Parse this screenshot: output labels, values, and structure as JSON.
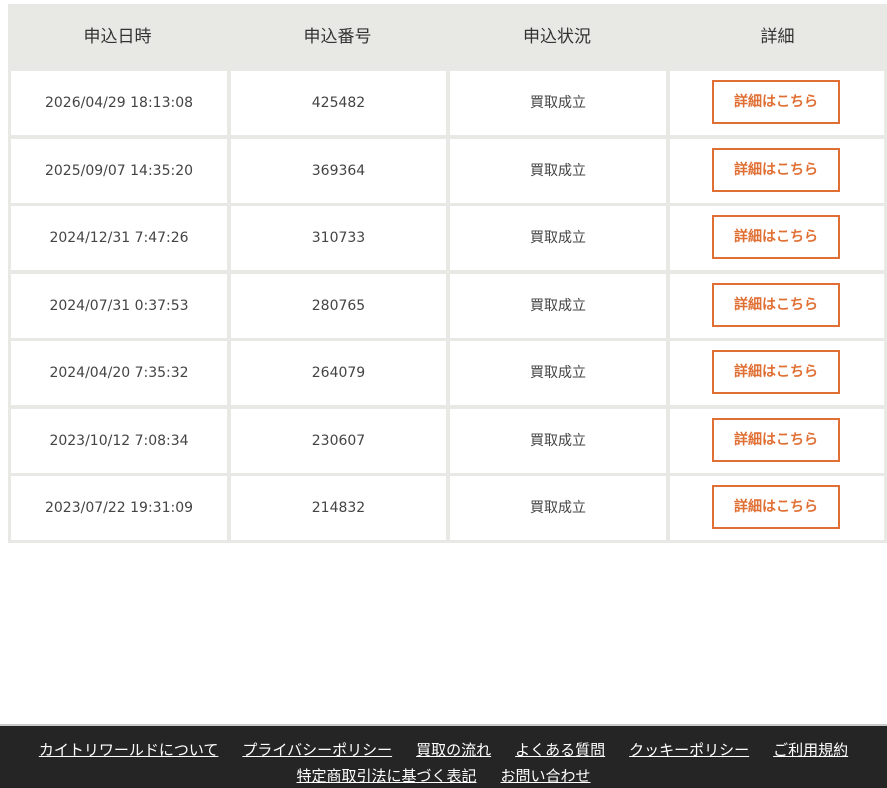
{
  "table": {
    "headers": [
      "申込日時",
      "申込番号",
      "申込状況",
      "詳細"
    ],
    "rows": [
      {
        "date": "2026/04/29 18:13:08",
        "number": "425482",
        "status": "買取成立",
        "detail_label": "詳細はこちら"
      },
      {
        "date": "2025/09/07 14:35:20",
        "number": "369364",
        "status": "買取成立",
        "detail_label": "詳細はこちら"
      },
      {
        "date": "2024/12/31 7:47:26",
        "number": "310733",
        "status": "買取成立",
        "detail_label": "詳細はこちら"
      },
      {
        "date": "2024/07/31 0:37:53",
        "number": "280765",
        "status": "買取成立",
        "detail_label": "詳細はこちら"
      },
      {
        "date": "2024/04/20 7:35:32",
        "number": "264079",
        "status": "買取成立",
        "detail_label": "詳細はこちら"
      },
      {
        "date": "2023/10/12 7:08:34",
        "number": "230607",
        "status": "買取成立",
        "detail_label": "詳細はこちら"
      },
      {
        "date": "2023/07/22 19:31:09",
        "number": "214832",
        "status": "買取成立",
        "detail_label": "詳細はこちら"
      }
    ]
  },
  "footer": {
    "links_row1": [
      "カイトリワールドについて",
      "プライバシーポリシー",
      "買取の流れ",
      "よくある質問",
      "クッキーポリシー",
      "ご利用規約"
    ],
    "links_row2": [
      "特定商取引法に基づく表記",
      "お問い合わせ"
    ]
  },
  "colors": {
    "accent": "#e06f33",
    "header_bg": "#e8e8e4",
    "footer_bg": "#252525"
  }
}
